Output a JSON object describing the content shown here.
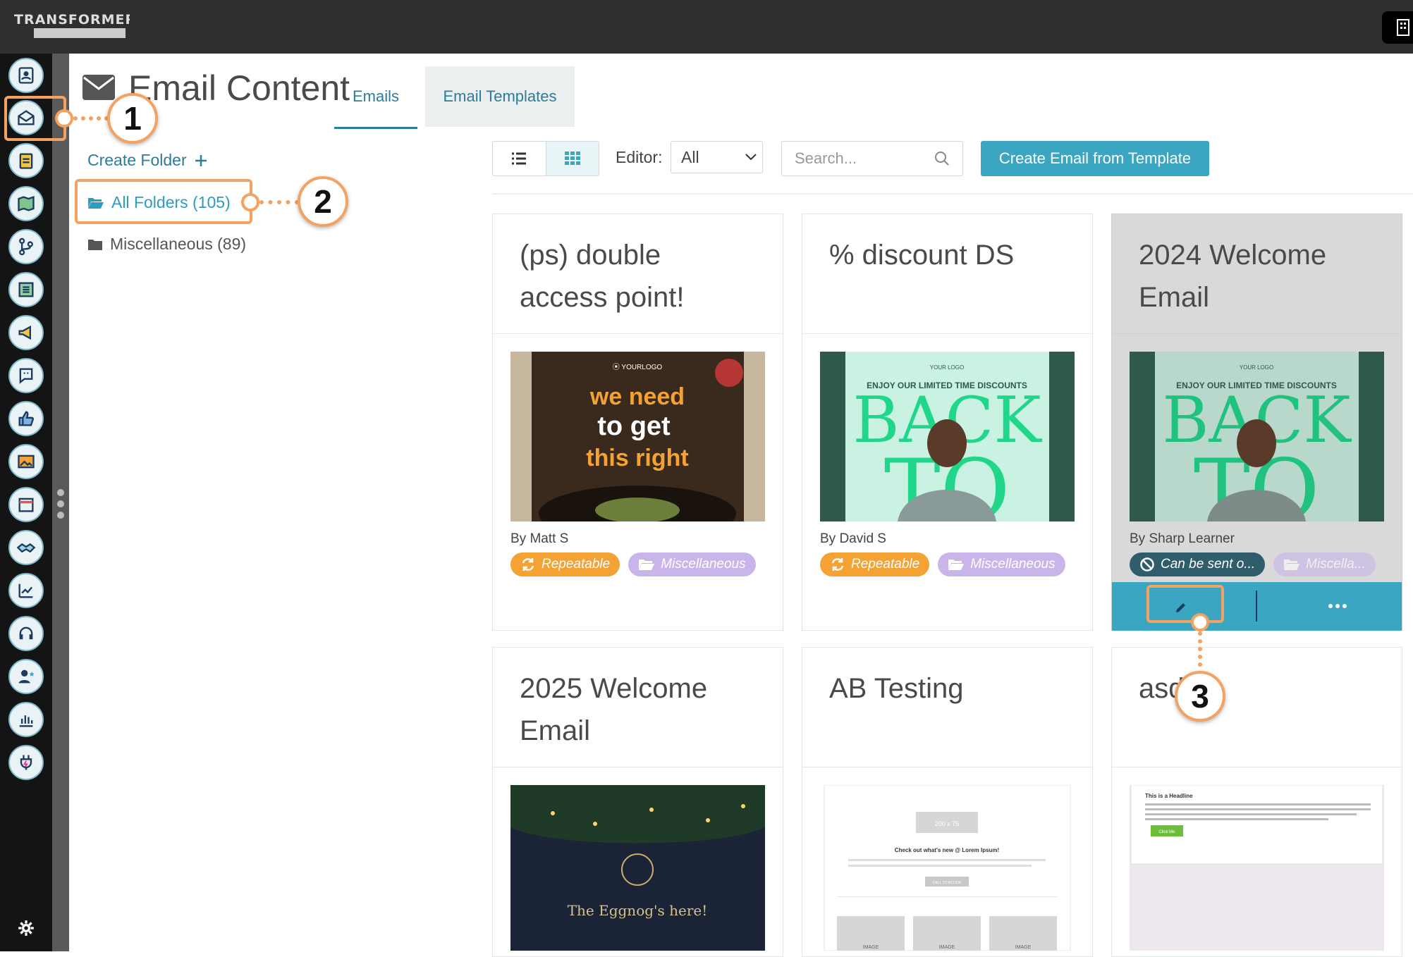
{
  "app": {
    "logo_text": "TRANSFORMERS"
  },
  "page": {
    "title": "Email Content"
  },
  "tabs": [
    {
      "label": "Emails"
    },
    {
      "label": "Email Templates"
    }
  ],
  "folders": {
    "create_label": "Create Folder",
    "items": [
      {
        "label": "All Folders (105)"
      },
      {
        "label": "Miscellaneous (89)"
      }
    ]
  },
  "toolbar": {
    "editor_label": "Editor:",
    "editor_value": "All",
    "search_placeholder": "Search...",
    "create_button": "Create Email from Template"
  },
  "cards": [
    {
      "title": "(ps) double access point!",
      "author": "By Matt S",
      "badges": [
        "Repeatable",
        "Miscellaneous"
      ],
      "thumb_lines": [
        "⦿ YOURLOGO",
        "we need",
        "to get",
        "this right"
      ]
    },
    {
      "title": "% discount DS",
      "author": "By David S",
      "badges": [
        "Repeatable",
        "Miscellaneous"
      ],
      "thumb_lines": [
        "YOUR LOGO",
        "ENJOY OUR LIMITED TIME DISCOUNTS",
        "BACK",
        "TO"
      ]
    },
    {
      "title": "2024 Welcome Email",
      "author": "By Sharp Learner",
      "badges": [
        "Can be sent o...",
        "Miscella..."
      ],
      "thumb_lines": [
        "YOUR LOGO",
        "ENJOY OUR LIMITED TIME DISCOUNTS",
        "BACK",
        "TO"
      ]
    },
    {
      "title": "2025 Welcome Email",
      "thumb_lines": [
        "The Eggnog's here!"
      ]
    },
    {
      "title": "AB Testing",
      "thumb_lines": [
        "200 x 75",
        "Check out what's new @ Lorem Ipsum!",
        "CALL TO ACTION",
        "IMAGE",
        "IMAGE",
        "IMAGE"
      ]
    },
    {
      "title": "asd",
      "thumb_lines": [
        "This is a Headline",
        "Click Me"
      ]
    }
  ],
  "annotations": {
    "one": "1",
    "two": "2",
    "three": "3"
  },
  "colors": {
    "accent": "#3aa6c2",
    "annotation": "#f4a261",
    "repeatable": "#f4a233",
    "folder_badge": "#c9b5ea"
  }
}
